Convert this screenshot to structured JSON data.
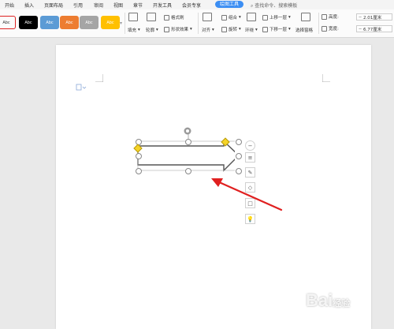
{
  "menu": {
    "items": [
      {
        "label": "开始"
      },
      {
        "label": "插入"
      },
      {
        "label": "页面布局"
      },
      {
        "label": "引用"
      },
      {
        "label": "审阅"
      },
      {
        "label": "视图"
      },
      {
        "label": "章节"
      },
      {
        "label": "开发工具"
      },
      {
        "label": "会员专享"
      },
      {
        "label": "绘图工具"
      }
    ],
    "search_placeholder": "查找命令、搜索模板"
  },
  "ribbon": {
    "style_swatches": [
      {
        "text": "Abc",
        "bg": "#ffffff",
        "fg": "#333333"
      },
      {
        "text": "Abc",
        "bg": "#000000",
        "fg": "#ffffff"
      },
      {
        "text": "Abc",
        "bg": "#5b9bd5",
        "fg": "#ffffff"
      },
      {
        "text": "Abc",
        "bg": "#ed7d31",
        "fg": "#ffffff"
      },
      {
        "text": "Abc",
        "bg": "#a5a5a5",
        "fg": "#ffffff"
      },
      {
        "text": "Abc",
        "bg": "#ffc000",
        "fg": "#ffffff"
      }
    ],
    "fill_label": "填充",
    "outline_label": "轮廓",
    "format_painter_label": "格式刷",
    "shape_effects_label": "形状效果",
    "align_label": "对齐",
    "group_label": "组合",
    "rotate_label": "旋转",
    "wrap_label": "环绕",
    "bring_forward_label": "上移一层",
    "send_backward_label": "下移一层",
    "selection_pane_label": "选择窗格",
    "height_label": "高度:",
    "height_value": "2.01厘米",
    "width_label": "宽度:",
    "width_value": "6.77厘米"
  },
  "watermark": {
    "text": "Bai",
    "suffix": "经验"
  },
  "colors": {
    "accent": "#3c8ef3",
    "arrow_annotation": "#e02020",
    "handle_yellow": "#f5d327"
  }
}
